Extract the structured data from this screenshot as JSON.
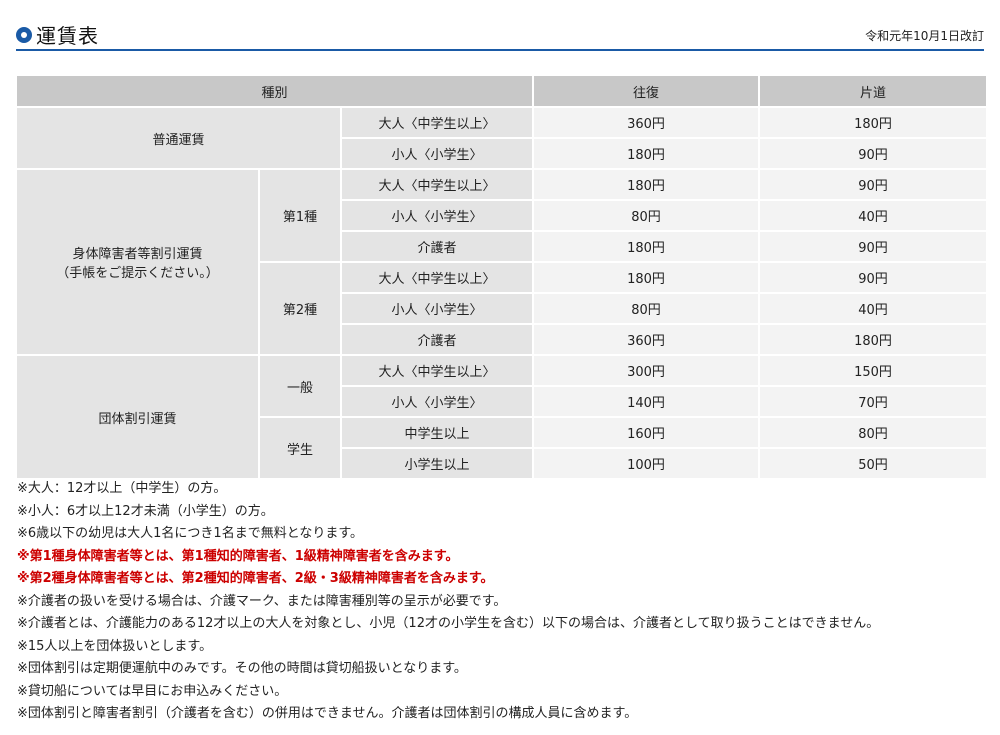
{
  "header": {
    "title": "運賃表",
    "revised": "令和元年10月1日改訂"
  },
  "table": {
    "head": {
      "kind": "種別",
      "round": "往復",
      "oneway": "片道"
    },
    "regular": {
      "label": "普通運賃",
      "rows": [
        {
          "kind": "大人〈中学生以上〉",
          "round": "360円",
          "oneway": "180円"
        },
        {
          "kind": "小人〈小学生〉",
          "round": "180円",
          "oneway": "90円"
        }
      ]
    },
    "disabled": {
      "label1": "身体障害者等割引運賃",
      "label2": "（手帳をご提示ください。）",
      "class1": {
        "label": "第1種",
        "rows": [
          {
            "kind": "大人〈中学生以上〉",
            "round": "180円",
            "oneway": "90円"
          },
          {
            "kind": "小人〈小学生〉",
            "round": "80円",
            "oneway": "40円"
          },
          {
            "kind": "介護者",
            "round": "180円",
            "oneway": "90円"
          }
        ]
      },
      "class2": {
        "label": "第2種",
        "rows": [
          {
            "kind": "大人〈中学生以上〉",
            "round": "180円",
            "oneway": "90円"
          },
          {
            "kind": "小人〈小学生〉",
            "round": "80円",
            "oneway": "40円"
          },
          {
            "kind": "介護者",
            "round": "360円",
            "oneway": "180円"
          }
        ]
      }
    },
    "group": {
      "label": "団体割引運賃",
      "general": {
        "label": "一般",
        "rows": [
          {
            "kind": "大人〈中学生以上〉",
            "round": "300円",
            "oneway": "150円"
          },
          {
            "kind": "小人〈小学生〉",
            "round": "140円",
            "oneway": "70円"
          }
        ]
      },
      "student": {
        "label": "学生",
        "rows": [
          {
            "kind": "中学生以上",
            "round": "160円",
            "oneway": "80円"
          },
          {
            "kind": "小学生以上",
            "round": "100円",
            "oneway": "50円"
          }
        ]
      }
    }
  },
  "notes": [
    "※大人：12才以上（中学生）の方。",
    "※小人：6才以上12才未満（小学生）の方。",
    "※6歳以下の幼児は大人1名につき1名まで無料となります。",
    "※第1種身体障害者等とは、第1種知的障害者、1級精神障害者を含みます。",
    "※第2種身体障害者等とは、第2種知的障害者、2級・3級精神障害者を含みます。",
    "※介護者の扱いを受ける場合は、介護マーク、または障害種別等の呈示が必要です。",
    "※介護者とは、介護能力のある12才以上の大人を対象とし、小児（12才の小学生を含む）以下の場合は、介護者として取り扱うことはできません。",
    "※15人以上を団体扱いとします。",
    "※団体割引は定期便運航中のみです。その他の時間は貸切船扱いとなります。",
    "※貸切船については早目にお申込みください。",
    "※団体割引と障害者割引（介護者を含む）の併用はできません。介護者は団体割引の構成人員に含めます。"
  ],
  "colors": {
    "accent": "#1a5aa6",
    "warning": "#cc0000"
  }
}
